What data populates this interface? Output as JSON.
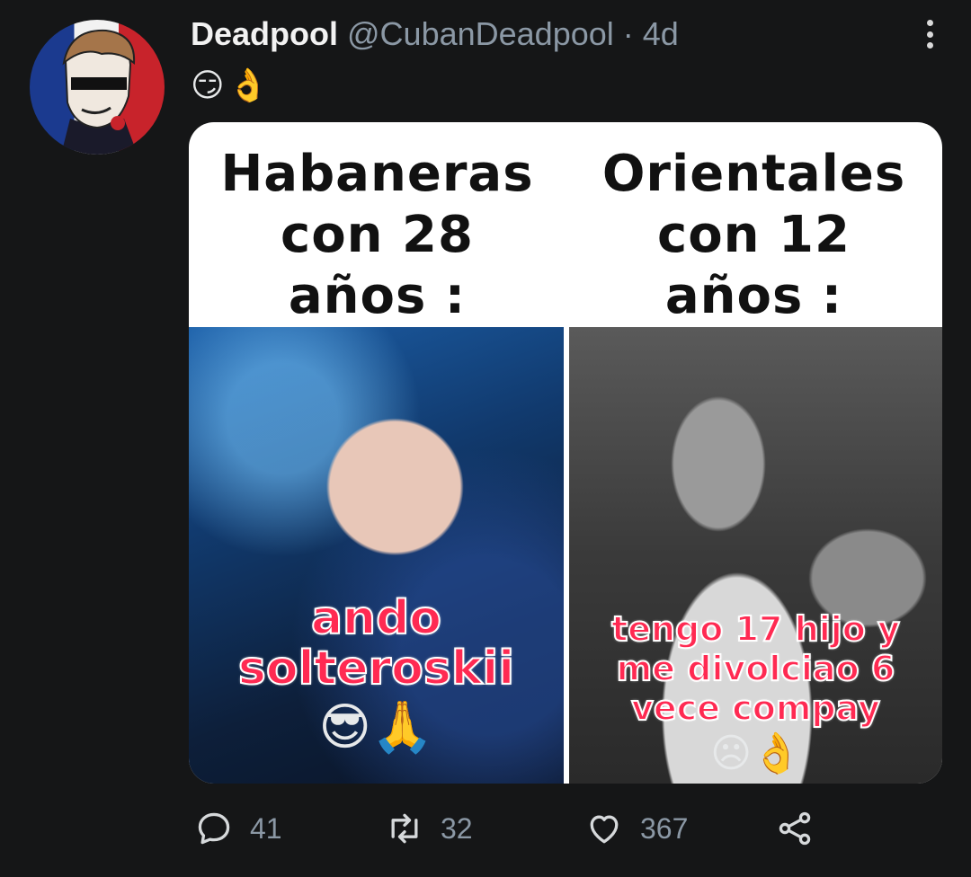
{
  "tweet": {
    "display_name": "Deadpool",
    "handle": "@CubanDeadpool",
    "separator": "·",
    "age": "4d",
    "emojis": [
      "😏",
      "👌"
    ]
  },
  "media": {
    "left_caption": [
      "Habaneras",
      "con 28",
      "años :"
    ],
    "right_caption": [
      "Orientales",
      "con 12",
      "años :"
    ],
    "left_overlay": [
      "ando",
      "solteroskii"
    ],
    "left_overlay_emojis": "😎🙏",
    "right_overlay": [
      "tengo 17 hijo y",
      "me divolciao 6",
      "vece compay"
    ],
    "right_overlay_emojis": "☹👌"
  },
  "actions": {
    "reply_count": "41",
    "retweet_count": "32",
    "like_count": "367",
    "icons": [
      "reply-icon",
      "retweet-icon",
      "like-icon",
      "share-icon"
    ]
  },
  "colors": {
    "background": "#151617",
    "meme_text": "#ff2a52",
    "muted": "#8b98a5"
  }
}
